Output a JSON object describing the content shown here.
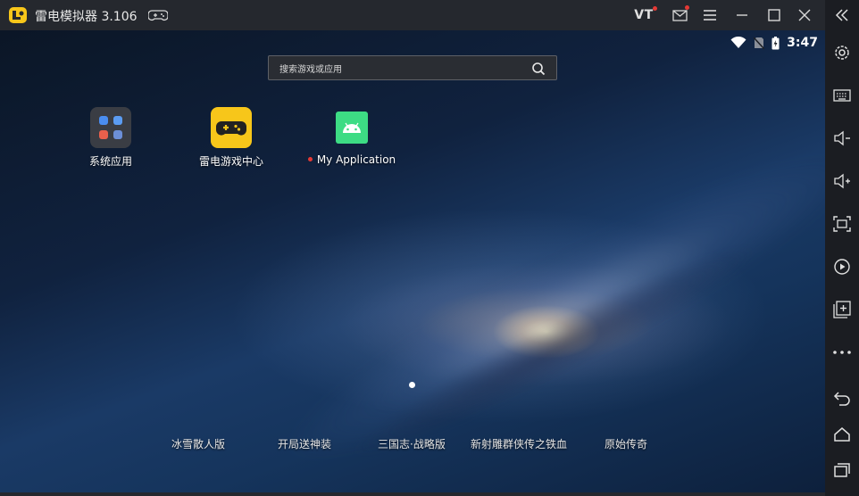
{
  "titlebar": {
    "app_title": "雷电模拟器 3.106",
    "vt_label": "VT",
    "icons": [
      "ldplayer-logo-icon",
      "gamepad-icon",
      "mail-icon",
      "menu-icon",
      "minimize-icon",
      "maximize-icon",
      "close-icon"
    ]
  },
  "status_bar": {
    "time": "3:47",
    "icons": [
      "wifi-icon",
      "no-sim-icon",
      "battery-charging-icon"
    ]
  },
  "search": {
    "placeholder": "搜索游戏或应用"
  },
  "apps": [
    {
      "label": "系统应用",
      "icon": "system-apps-folder-icon"
    },
    {
      "label": "雷电游戏中心",
      "icon": "game-center-icon",
      "color": "#f7c61a"
    },
    {
      "label": "My Application",
      "icon": "android-icon",
      "color": "#3ddc84",
      "new_badge": true
    }
  ],
  "games": [
    "冰雪散人版",
    "开局送神装",
    "三国志·战略版",
    "新射雕群侠传之铁血",
    "原始传奇"
  ],
  "sidebar": {
    "items": [
      "collapse-icon",
      "settings-icon",
      "keyboard-icon",
      "volume-down-icon",
      "volume-up-icon",
      "screenshot-icon",
      "record-icon",
      "add-window-icon",
      "more-icon",
      "back-icon",
      "home-icon",
      "recents-icon"
    ]
  },
  "colors": {
    "titlebar": "#25282e",
    "sidebar": "#1b1d22",
    "accent_red": "#e53935",
    "logo_yellow": "#f7c61a"
  }
}
